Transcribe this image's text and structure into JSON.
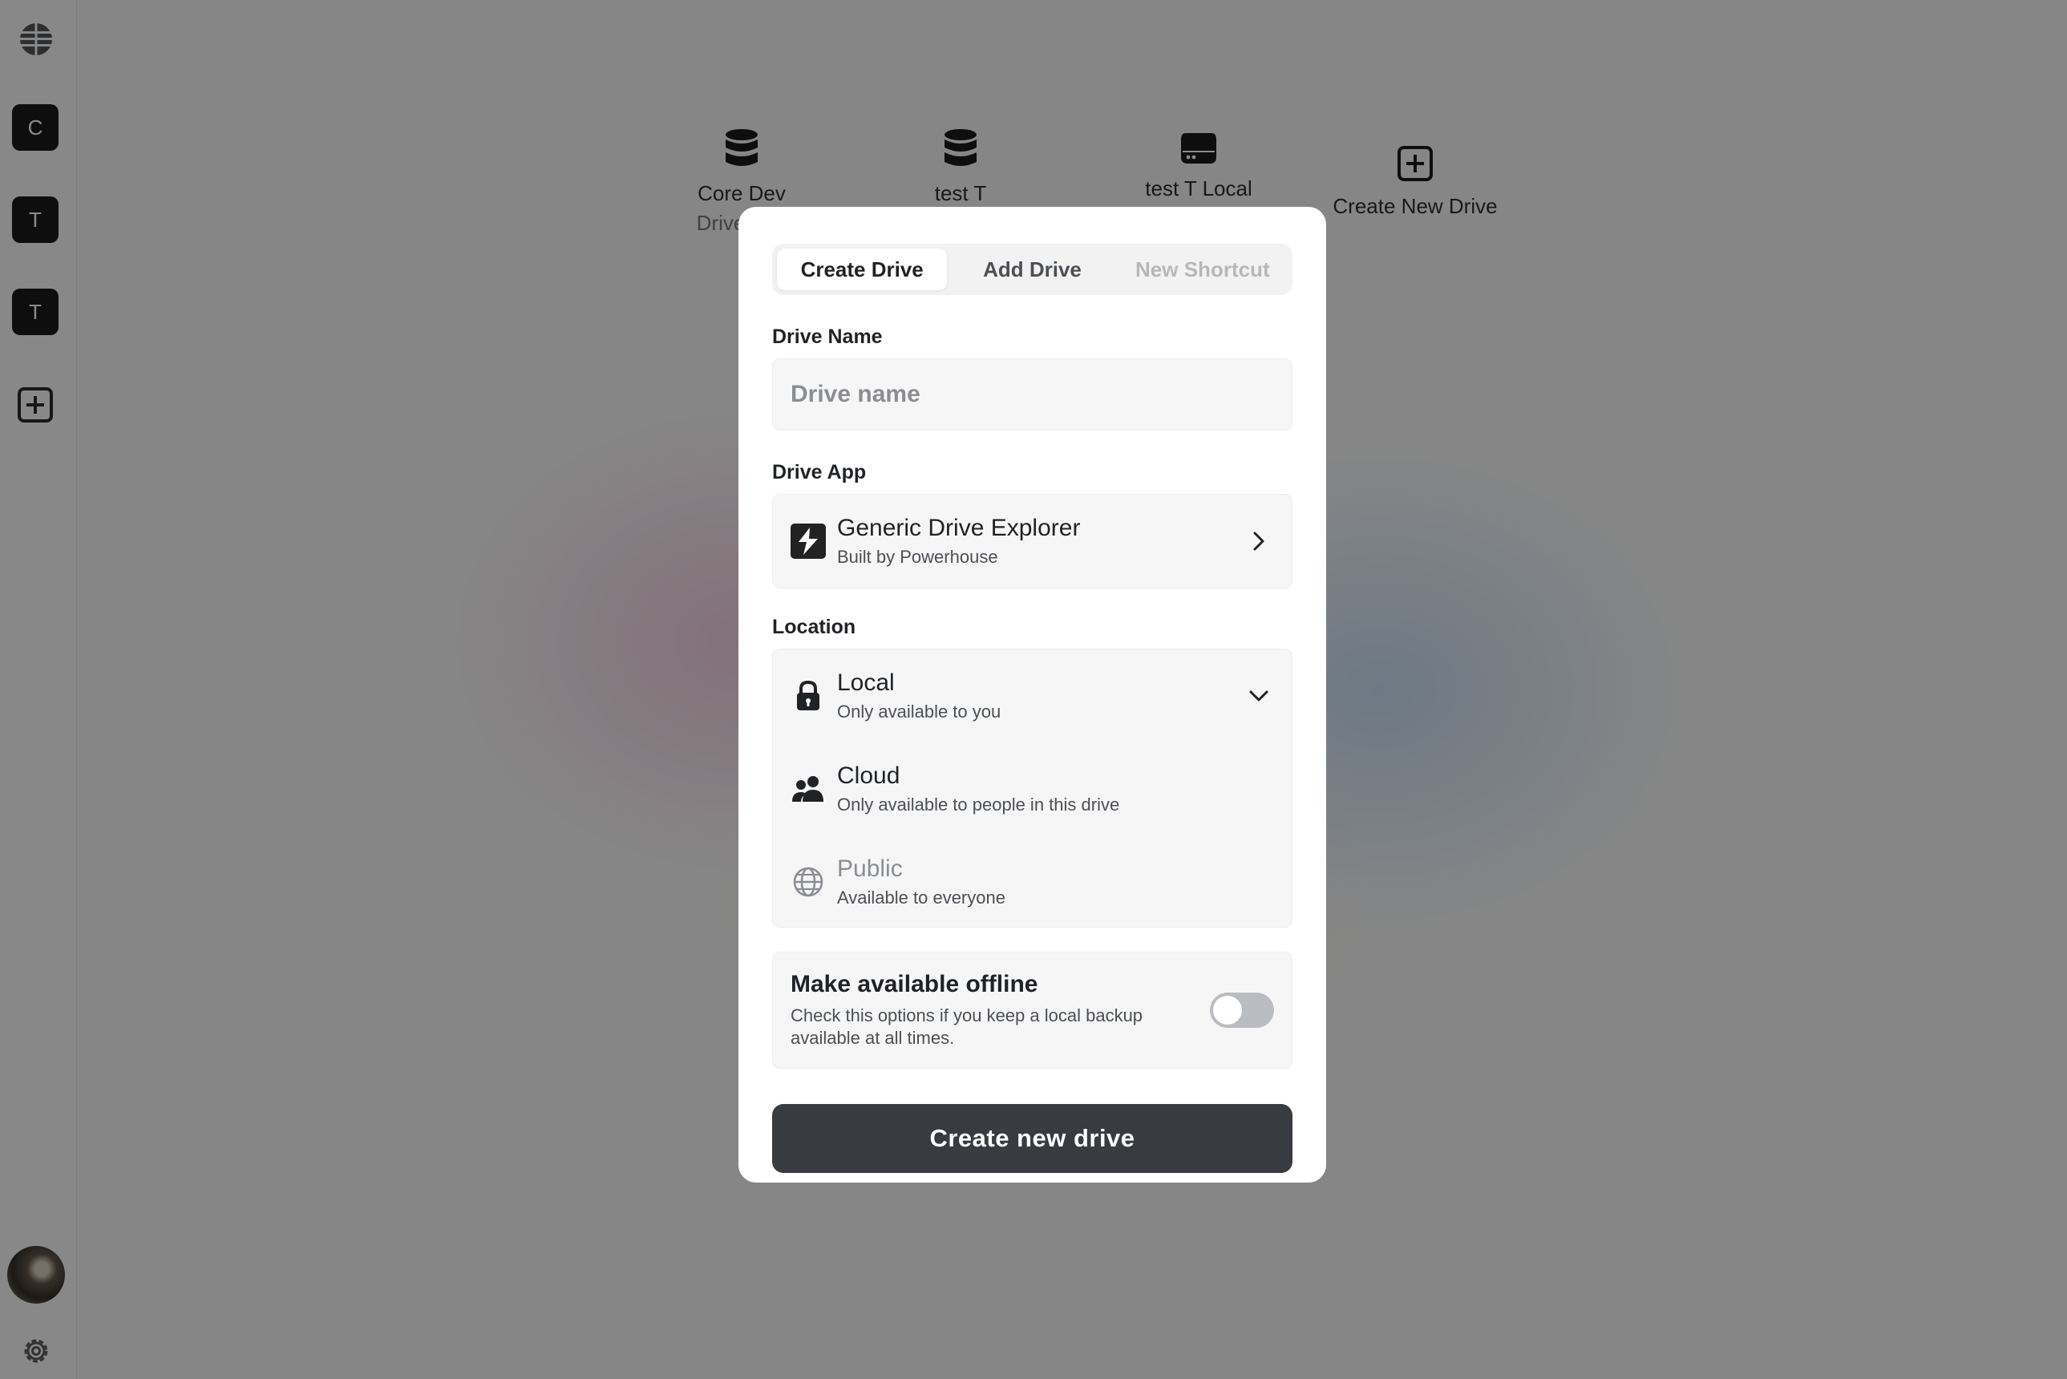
{
  "sidebar": {
    "items": [
      {
        "label": "C"
      },
      {
        "label": "T"
      },
      {
        "label": "T"
      }
    ]
  },
  "drives": [
    {
      "name": "Core Dev",
      "subtitle": "Drive Exp",
      "icon": "database-icon"
    },
    {
      "name": "test T",
      "icon": "database-icon"
    },
    {
      "name": "test T Local",
      "icon": "hard-drive-icon"
    },
    {
      "name": "Create New Drive",
      "icon": "plus-square-icon"
    }
  ],
  "modal": {
    "tabs": [
      {
        "label": "Create Drive",
        "state": "active"
      },
      {
        "label": "Add Drive",
        "state": "normal"
      },
      {
        "label": "New Shortcut",
        "state": "disabled"
      }
    ],
    "drive_name": {
      "label": "Drive Name",
      "placeholder": "Drive name",
      "value": ""
    },
    "drive_app": {
      "label": "Drive App",
      "name": "Generic Drive Explorer",
      "author": "Built by Powerhouse",
      "icon": "powerhouse-logo-icon"
    },
    "location": {
      "label": "Location",
      "selected": "Local",
      "options": [
        {
          "title": "Local",
          "desc": "Only available to you",
          "icon": "lock-icon"
        },
        {
          "title": "Cloud",
          "desc": "Only available to people in this drive",
          "icon": "people-icon"
        },
        {
          "title": "Public",
          "desc": "Available to everyone",
          "icon": "globe-icon"
        }
      ]
    },
    "offline": {
      "title": "Make available offline",
      "desc": "Check this options if you keep a local backup available at all times.",
      "enabled": false
    },
    "submit_label": "Create new drive"
  },
  "colors": {
    "overlay": "#0c0c0c",
    "button": "#383c40",
    "toggle_off": "#b9bcc0"
  }
}
